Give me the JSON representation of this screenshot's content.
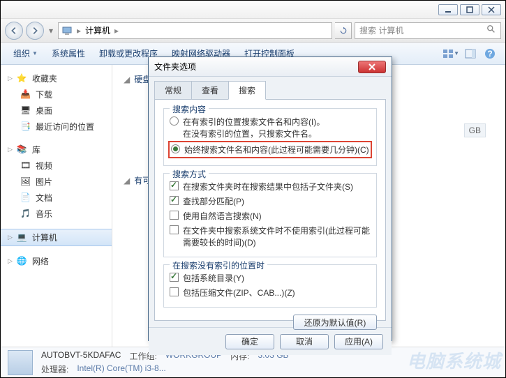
{
  "window": {
    "min_tip": "最小化",
    "max_tip": "还原",
    "close_tip": "关闭"
  },
  "nav": {
    "breadcrumb": [
      "计算机"
    ],
    "search_placeholder": "搜索 计算机",
    "refresh_tip": "刷新"
  },
  "toolbar": {
    "items": [
      "组织",
      "系统属性",
      "卸载或更改程序",
      "映射网络驱动器",
      "打开控制面板"
    ]
  },
  "sidebar": {
    "groups": [
      {
        "header": "收藏夹",
        "icon": "star",
        "items": [
          {
            "label": "下载",
            "icon": "download"
          },
          {
            "label": "桌面",
            "icon": "desktop"
          },
          {
            "label": "最近访问的位置",
            "icon": "recent"
          }
        ]
      },
      {
        "header": "库",
        "icon": "library",
        "items": [
          {
            "label": "视频",
            "icon": "video"
          },
          {
            "label": "图片",
            "icon": "pictures"
          },
          {
            "label": "文档",
            "icon": "documents"
          },
          {
            "label": "音乐",
            "icon": "music"
          }
        ]
      },
      {
        "header": "计算机",
        "icon": "computer",
        "selected": true,
        "items": []
      },
      {
        "header": "网络",
        "icon": "network",
        "items": []
      }
    ]
  },
  "content": {
    "sections": [
      {
        "label": "硬盘 (",
        "trail": ""
      },
      {
        "label": "有可移",
        "trail": ""
      }
    ],
    "gb_badge": "GB"
  },
  "dialog": {
    "title": "文件夹选项",
    "tabs": [
      "常规",
      "查看",
      "搜索"
    ],
    "active_tab": 2,
    "group1": {
      "legend": "搜索内容",
      "opt1": "在有索引的位置搜索文件名和内容(I)。",
      "opt1b": "在没有索引的位置，只搜索文件名。",
      "opt2": "始终搜索文件名和内容(此过程可能需要几分钟)(C)"
    },
    "group2": {
      "legend": "搜索方式",
      "chk1": "在搜索文件夹时在搜索结果中包括子文件夹(S)",
      "chk2": "查找部分匹配(P)",
      "chk3": "使用自然语言搜索(N)",
      "chk4": "在文件夹中搜索系统文件时不使用索引(此过程可能需要较长的时间)(D)"
    },
    "group3": {
      "legend": "在搜索没有索引的位置时",
      "chk1": "包括系统目录(Y)",
      "chk2": "包括压缩文件(ZIP、CAB...)(Z)"
    },
    "reset": "还原为默认值(R)",
    "ok": "确定",
    "cancel": "取消",
    "apply": "应用(A)"
  },
  "status": {
    "name": "AUTOBVT-5KDAFAC",
    "workgroup_lbl": "工作组:",
    "workgroup": "WORKGROUP",
    "mem_lbl": "内存:",
    "mem": "3.03 GB",
    "cpu_lbl": "处理器:",
    "cpu": "Intel(R) Core(TM) i3-8..."
  },
  "watermark": "电脑系统城"
}
